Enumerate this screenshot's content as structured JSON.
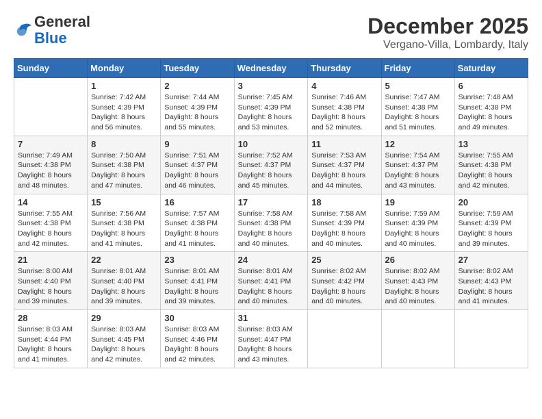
{
  "logo": {
    "general": "General",
    "blue": "Blue"
  },
  "header": {
    "month": "December 2025",
    "location": "Vergano-Villa, Lombardy, Italy"
  },
  "weekdays": [
    "Sunday",
    "Monday",
    "Tuesday",
    "Wednesday",
    "Thursday",
    "Friday",
    "Saturday"
  ],
  "weeks": [
    [
      {
        "day": "",
        "sunrise": "",
        "sunset": "",
        "daylight": ""
      },
      {
        "day": "1",
        "sunrise": "Sunrise: 7:42 AM",
        "sunset": "Sunset: 4:39 PM",
        "daylight": "Daylight: 8 hours and 56 minutes."
      },
      {
        "day": "2",
        "sunrise": "Sunrise: 7:44 AM",
        "sunset": "Sunset: 4:39 PM",
        "daylight": "Daylight: 8 hours and 55 minutes."
      },
      {
        "day": "3",
        "sunrise": "Sunrise: 7:45 AM",
        "sunset": "Sunset: 4:39 PM",
        "daylight": "Daylight: 8 hours and 53 minutes."
      },
      {
        "day": "4",
        "sunrise": "Sunrise: 7:46 AM",
        "sunset": "Sunset: 4:38 PM",
        "daylight": "Daylight: 8 hours and 52 minutes."
      },
      {
        "day": "5",
        "sunrise": "Sunrise: 7:47 AM",
        "sunset": "Sunset: 4:38 PM",
        "daylight": "Daylight: 8 hours and 51 minutes."
      },
      {
        "day": "6",
        "sunrise": "Sunrise: 7:48 AM",
        "sunset": "Sunset: 4:38 PM",
        "daylight": "Daylight: 8 hours and 49 minutes."
      }
    ],
    [
      {
        "day": "7",
        "sunrise": "Sunrise: 7:49 AM",
        "sunset": "Sunset: 4:38 PM",
        "daylight": "Daylight: 8 hours and 48 minutes."
      },
      {
        "day": "8",
        "sunrise": "Sunrise: 7:50 AM",
        "sunset": "Sunset: 4:38 PM",
        "daylight": "Daylight: 8 hours and 47 minutes."
      },
      {
        "day": "9",
        "sunrise": "Sunrise: 7:51 AM",
        "sunset": "Sunset: 4:37 PM",
        "daylight": "Daylight: 8 hours and 46 minutes."
      },
      {
        "day": "10",
        "sunrise": "Sunrise: 7:52 AM",
        "sunset": "Sunset: 4:37 PM",
        "daylight": "Daylight: 8 hours and 45 minutes."
      },
      {
        "day": "11",
        "sunrise": "Sunrise: 7:53 AM",
        "sunset": "Sunset: 4:37 PM",
        "daylight": "Daylight: 8 hours and 44 minutes."
      },
      {
        "day": "12",
        "sunrise": "Sunrise: 7:54 AM",
        "sunset": "Sunset: 4:37 PM",
        "daylight": "Daylight: 8 hours and 43 minutes."
      },
      {
        "day": "13",
        "sunrise": "Sunrise: 7:55 AM",
        "sunset": "Sunset: 4:38 PM",
        "daylight": "Daylight: 8 hours and 42 minutes."
      }
    ],
    [
      {
        "day": "14",
        "sunrise": "Sunrise: 7:55 AM",
        "sunset": "Sunset: 4:38 PM",
        "daylight": "Daylight: 8 hours and 42 minutes."
      },
      {
        "day": "15",
        "sunrise": "Sunrise: 7:56 AM",
        "sunset": "Sunset: 4:38 PM",
        "daylight": "Daylight: 8 hours and 41 minutes."
      },
      {
        "day": "16",
        "sunrise": "Sunrise: 7:57 AM",
        "sunset": "Sunset: 4:38 PM",
        "daylight": "Daylight: 8 hours and 41 minutes."
      },
      {
        "day": "17",
        "sunrise": "Sunrise: 7:58 AM",
        "sunset": "Sunset: 4:38 PM",
        "daylight": "Daylight: 8 hours and 40 minutes."
      },
      {
        "day": "18",
        "sunrise": "Sunrise: 7:58 AM",
        "sunset": "Sunset: 4:39 PM",
        "daylight": "Daylight: 8 hours and 40 minutes."
      },
      {
        "day": "19",
        "sunrise": "Sunrise: 7:59 AM",
        "sunset": "Sunset: 4:39 PM",
        "daylight": "Daylight: 8 hours and 40 minutes."
      },
      {
        "day": "20",
        "sunrise": "Sunrise: 7:59 AM",
        "sunset": "Sunset: 4:39 PM",
        "daylight": "Daylight: 8 hours and 39 minutes."
      }
    ],
    [
      {
        "day": "21",
        "sunrise": "Sunrise: 8:00 AM",
        "sunset": "Sunset: 4:40 PM",
        "daylight": "Daylight: 8 hours and 39 minutes."
      },
      {
        "day": "22",
        "sunrise": "Sunrise: 8:01 AM",
        "sunset": "Sunset: 4:40 PM",
        "daylight": "Daylight: 8 hours and 39 minutes."
      },
      {
        "day": "23",
        "sunrise": "Sunrise: 8:01 AM",
        "sunset": "Sunset: 4:41 PM",
        "daylight": "Daylight: 8 hours and 39 minutes."
      },
      {
        "day": "24",
        "sunrise": "Sunrise: 8:01 AM",
        "sunset": "Sunset: 4:41 PM",
        "daylight": "Daylight: 8 hours and 40 minutes."
      },
      {
        "day": "25",
        "sunrise": "Sunrise: 8:02 AM",
        "sunset": "Sunset: 4:42 PM",
        "daylight": "Daylight: 8 hours and 40 minutes."
      },
      {
        "day": "26",
        "sunrise": "Sunrise: 8:02 AM",
        "sunset": "Sunset: 4:43 PM",
        "daylight": "Daylight: 8 hours and 40 minutes."
      },
      {
        "day": "27",
        "sunrise": "Sunrise: 8:02 AM",
        "sunset": "Sunset: 4:43 PM",
        "daylight": "Daylight: 8 hours and 41 minutes."
      }
    ],
    [
      {
        "day": "28",
        "sunrise": "Sunrise: 8:03 AM",
        "sunset": "Sunset: 4:44 PM",
        "daylight": "Daylight: 8 hours and 41 minutes."
      },
      {
        "day": "29",
        "sunrise": "Sunrise: 8:03 AM",
        "sunset": "Sunset: 4:45 PM",
        "daylight": "Daylight: 8 hours and 42 minutes."
      },
      {
        "day": "30",
        "sunrise": "Sunrise: 8:03 AM",
        "sunset": "Sunset: 4:46 PM",
        "daylight": "Daylight: 8 hours and 42 minutes."
      },
      {
        "day": "31",
        "sunrise": "Sunrise: 8:03 AM",
        "sunset": "Sunset: 4:47 PM",
        "daylight": "Daylight: 8 hours and 43 minutes."
      },
      {
        "day": "",
        "sunrise": "",
        "sunset": "",
        "daylight": ""
      },
      {
        "day": "",
        "sunrise": "",
        "sunset": "",
        "daylight": ""
      },
      {
        "day": "",
        "sunrise": "",
        "sunset": "",
        "daylight": ""
      }
    ]
  ]
}
